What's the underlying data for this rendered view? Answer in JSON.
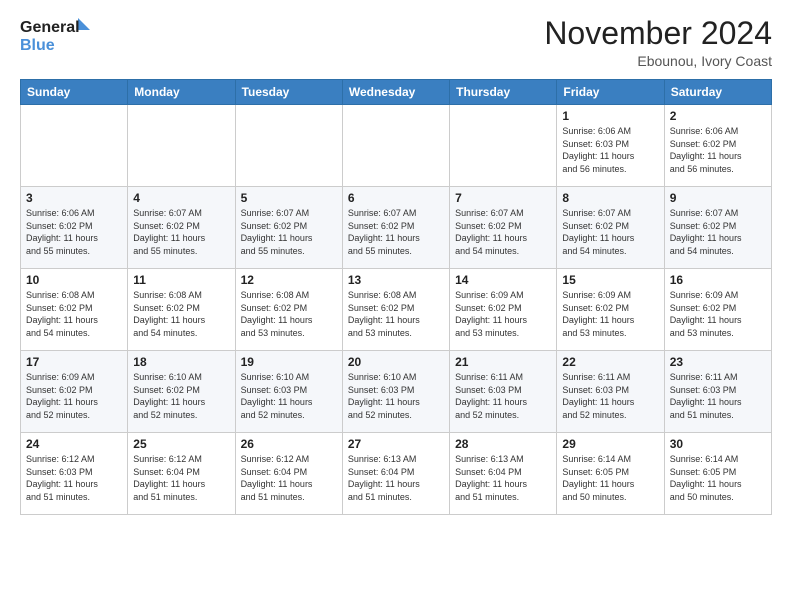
{
  "header": {
    "logo_line1": "General",
    "logo_line2": "Blue",
    "month_title": "November 2024",
    "location": "Ebounou, Ivory Coast"
  },
  "weekdays": [
    "Sunday",
    "Monday",
    "Tuesday",
    "Wednesday",
    "Thursday",
    "Friday",
    "Saturday"
  ],
  "weeks": [
    [
      {
        "day": "",
        "info": ""
      },
      {
        "day": "",
        "info": ""
      },
      {
        "day": "",
        "info": ""
      },
      {
        "day": "",
        "info": ""
      },
      {
        "day": "",
        "info": ""
      },
      {
        "day": "1",
        "info": "Sunrise: 6:06 AM\nSunset: 6:03 PM\nDaylight: 11 hours\nand 56 minutes."
      },
      {
        "day": "2",
        "info": "Sunrise: 6:06 AM\nSunset: 6:02 PM\nDaylight: 11 hours\nand 56 minutes."
      }
    ],
    [
      {
        "day": "3",
        "info": "Sunrise: 6:06 AM\nSunset: 6:02 PM\nDaylight: 11 hours\nand 55 minutes."
      },
      {
        "day": "4",
        "info": "Sunrise: 6:07 AM\nSunset: 6:02 PM\nDaylight: 11 hours\nand 55 minutes."
      },
      {
        "day": "5",
        "info": "Sunrise: 6:07 AM\nSunset: 6:02 PM\nDaylight: 11 hours\nand 55 minutes."
      },
      {
        "day": "6",
        "info": "Sunrise: 6:07 AM\nSunset: 6:02 PM\nDaylight: 11 hours\nand 55 minutes."
      },
      {
        "day": "7",
        "info": "Sunrise: 6:07 AM\nSunset: 6:02 PM\nDaylight: 11 hours\nand 54 minutes."
      },
      {
        "day": "8",
        "info": "Sunrise: 6:07 AM\nSunset: 6:02 PM\nDaylight: 11 hours\nand 54 minutes."
      },
      {
        "day": "9",
        "info": "Sunrise: 6:07 AM\nSunset: 6:02 PM\nDaylight: 11 hours\nand 54 minutes."
      }
    ],
    [
      {
        "day": "10",
        "info": "Sunrise: 6:08 AM\nSunset: 6:02 PM\nDaylight: 11 hours\nand 54 minutes."
      },
      {
        "day": "11",
        "info": "Sunrise: 6:08 AM\nSunset: 6:02 PM\nDaylight: 11 hours\nand 54 minutes."
      },
      {
        "day": "12",
        "info": "Sunrise: 6:08 AM\nSunset: 6:02 PM\nDaylight: 11 hours\nand 53 minutes."
      },
      {
        "day": "13",
        "info": "Sunrise: 6:08 AM\nSunset: 6:02 PM\nDaylight: 11 hours\nand 53 minutes."
      },
      {
        "day": "14",
        "info": "Sunrise: 6:09 AM\nSunset: 6:02 PM\nDaylight: 11 hours\nand 53 minutes."
      },
      {
        "day": "15",
        "info": "Sunrise: 6:09 AM\nSunset: 6:02 PM\nDaylight: 11 hours\nand 53 minutes."
      },
      {
        "day": "16",
        "info": "Sunrise: 6:09 AM\nSunset: 6:02 PM\nDaylight: 11 hours\nand 53 minutes."
      }
    ],
    [
      {
        "day": "17",
        "info": "Sunrise: 6:09 AM\nSunset: 6:02 PM\nDaylight: 11 hours\nand 52 minutes."
      },
      {
        "day": "18",
        "info": "Sunrise: 6:10 AM\nSunset: 6:02 PM\nDaylight: 11 hours\nand 52 minutes."
      },
      {
        "day": "19",
        "info": "Sunrise: 6:10 AM\nSunset: 6:03 PM\nDaylight: 11 hours\nand 52 minutes."
      },
      {
        "day": "20",
        "info": "Sunrise: 6:10 AM\nSunset: 6:03 PM\nDaylight: 11 hours\nand 52 minutes."
      },
      {
        "day": "21",
        "info": "Sunrise: 6:11 AM\nSunset: 6:03 PM\nDaylight: 11 hours\nand 52 minutes."
      },
      {
        "day": "22",
        "info": "Sunrise: 6:11 AM\nSunset: 6:03 PM\nDaylight: 11 hours\nand 52 minutes."
      },
      {
        "day": "23",
        "info": "Sunrise: 6:11 AM\nSunset: 6:03 PM\nDaylight: 11 hours\nand 51 minutes."
      }
    ],
    [
      {
        "day": "24",
        "info": "Sunrise: 6:12 AM\nSunset: 6:03 PM\nDaylight: 11 hours\nand 51 minutes."
      },
      {
        "day": "25",
        "info": "Sunrise: 6:12 AM\nSunset: 6:04 PM\nDaylight: 11 hours\nand 51 minutes."
      },
      {
        "day": "26",
        "info": "Sunrise: 6:12 AM\nSunset: 6:04 PM\nDaylight: 11 hours\nand 51 minutes."
      },
      {
        "day": "27",
        "info": "Sunrise: 6:13 AM\nSunset: 6:04 PM\nDaylight: 11 hours\nand 51 minutes."
      },
      {
        "day": "28",
        "info": "Sunrise: 6:13 AM\nSunset: 6:04 PM\nDaylight: 11 hours\nand 51 minutes."
      },
      {
        "day": "29",
        "info": "Sunrise: 6:14 AM\nSunset: 6:05 PM\nDaylight: 11 hours\nand 50 minutes."
      },
      {
        "day": "30",
        "info": "Sunrise: 6:14 AM\nSunset: 6:05 PM\nDaylight: 11 hours\nand 50 minutes."
      }
    ]
  ]
}
